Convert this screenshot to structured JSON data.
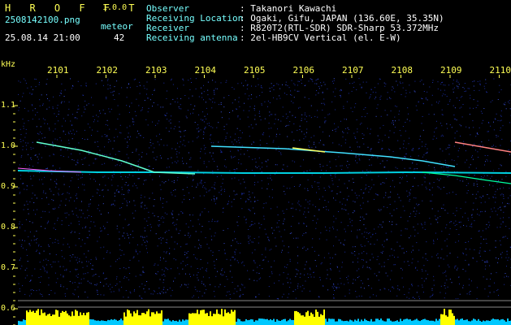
{
  "app": {
    "name": "H R O F F T",
    "version": "1.0.0"
  },
  "file": {
    "name": "2508142100.png",
    "datetime": "25.08.14 21:00"
  },
  "counter": {
    "label": "meteor",
    "value": "42"
  },
  "info": {
    "observer_label": "Observer",
    "observer": ": Takanori Kawachi",
    "location_label": "Receiving Location",
    "location": ": Ogaki, Gifu, JAPAN (136.60E, 35.35N)",
    "receiver_label": "Receiver",
    "receiver": ": R820T2(RTL-SDR) SDR-Sharp 53.372MHz",
    "antenna_label": "Receiving antenna",
    "antenna": ": 2el-HB9CV Vertical (el. E-W)"
  },
  "axis": {
    "unit": "kHz",
    "time_ticks": [
      "2101",
      "2102",
      "2103",
      "2104",
      "2105",
      "2106",
      "2107",
      "2108",
      "2109",
      "2110"
    ],
    "freq_ticks": [
      "1.1",
      "1.0",
      "0.9",
      "0.8",
      "0.7",
      "0.6"
    ]
  },
  "colors": {
    "background": "#000",
    "labels": "#ffff55",
    "info_text": "#77ffff",
    "signal": "#00ffff",
    "level": "#ffff00"
  }
}
